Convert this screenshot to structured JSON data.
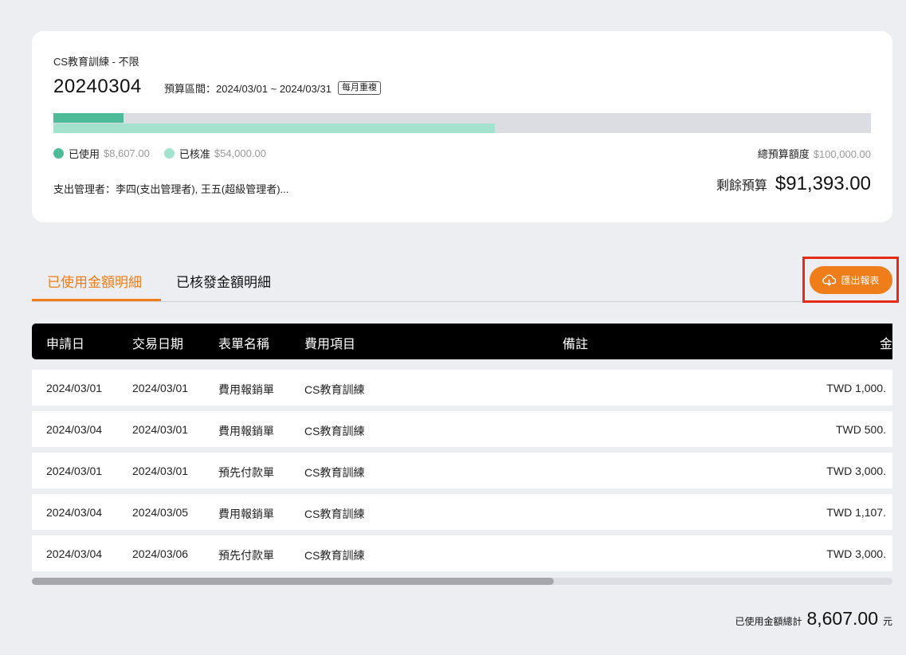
{
  "budget": {
    "name": "CS教育訓練 - 不限",
    "code": "20240304",
    "period": "預算區間：2024/03/01 ~ 2024/03/31",
    "recurrence": "每月重複",
    "used_label": "已使用",
    "used_amount": "$8,607.00",
    "approved_label": "已核准",
    "approved_amount": "$54,000.00",
    "total_label": "總預算額度",
    "total_amount": "$100,000.00",
    "used_fraction": 0.086,
    "approved_fraction": 0.54,
    "managers": "支出管理者：李四(支出管理者), 王五(超級管理者)...",
    "remaining_label": "剩餘預算",
    "remaining_amount": "$91,393.00"
  },
  "colors": {
    "accent": "#ef7d1a",
    "used": "#4dbb97",
    "approved": "#a3e2cc",
    "highlight": "#e52a16"
  },
  "tabs": [
    {
      "label": "已使用金額明細",
      "active": true
    },
    {
      "label": "已核發金額明細",
      "active": false
    }
  ],
  "export": {
    "label": "匯出報表",
    "icon": "cloud-download-icon"
  },
  "table": {
    "headers": [
      "申請日",
      "交易日期",
      "表單名稱",
      "費用項目",
      "備註",
      "金"
    ],
    "rows": [
      [
        "2024/03/01",
        "2024/03/01",
        "費用報銷單",
        "CS教育訓練",
        "",
        "TWD 1,000."
      ],
      [
        "2024/03/04",
        "2024/03/01",
        "費用報銷單",
        "CS教育訓練",
        "",
        "TWD 500."
      ],
      [
        "2024/03/01",
        "2024/03/01",
        "預先付款單",
        "CS教育訓練",
        "",
        "TWD 3,000."
      ],
      [
        "2024/03/04",
        "2024/03/05",
        "費用報銷單",
        "CS教育訓練",
        "",
        "TWD 1,107."
      ],
      [
        "2024/03/04",
        "2024/03/06",
        "預先付款單",
        "CS教育訓練",
        "",
        "TWD 3,000."
      ]
    ]
  },
  "summary": {
    "label": "已使用金額總計",
    "value": "8,607.00",
    "unit": "元"
  }
}
